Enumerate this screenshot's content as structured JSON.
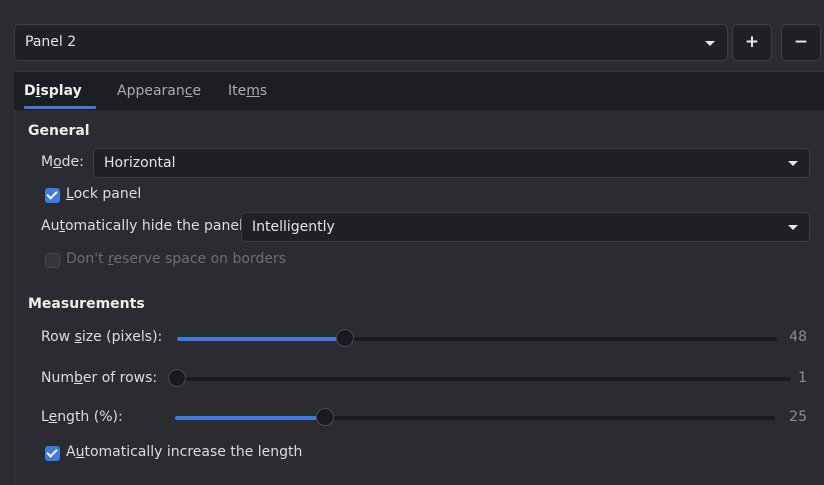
{
  "panel_selector": {
    "value": "Panel 2",
    "add_label": "+",
    "remove_label": "−"
  },
  "tabs": [
    {
      "label_pre": "D",
      "label_mn": "i",
      "label_post": "splay",
      "active": true
    },
    {
      "label_pre": "Appearan",
      "label_mn": "c",
      "label_post": "e",
      "active": false
    },
    {
      "label_pre": "Ite",
      "label_mn": "m",
      "label_post": "s",
      "active": false
    }
  ],
  "general": {
    "title": "General",
    "mode_label_pre": "M",
    "mode_label_mn": "o",
    "mode_label_post": "de:",
    "mode_value": "Horizontal",
    "lock_label_pre": "",
    "lock_label_mn": "L",
    "lock_label_post": "ock panel",
    "lock_checked": true,
    "autohide_label_pre": "Au",
    "autohide_label_mn": "t",
    "autohide_label_post": "omatically hide the panel:",
    "autohide_value": "Intelligently",
    "reserve_label_pre": "Don't ",
    "reserve_label_mn": "r",
    "reserve_label_post": "eserve space on borders",
    "reserve_checked": false
  },
  "measurements": {
    "title": "Measurements",
    "row_size_label_pre": "Row ",
    "row_size_label_mn": "s",
    "row_size_label_post": "ize (pixels):",
    "row_size_value": "48",
    "row_size_fraction": 0.28,
    "rows_label_pre": "Num",
    "rows_label_mn": "b",
    "rows_label_post": "er of rows:",
    "rows_value": "1",
    "rows_fraction": 0.0,
    "length_label_pre": "L",
    "length_label_mn": "e",
    "length_label_post": "ngth (%):",
    "length_value": "25",
    "length_fraction": 0.25,
    "auto_len_label_pre": "A",
    "auto_len_label_mn": "u",
    "auto_len_label_post": "tomatically increase the length",
    "auto_len_checked": true
  },
  "colors": {
    "accent": "#3d7be0",
    "background": "#2a2c30",
    "field": "#1f2125"
  }
}
